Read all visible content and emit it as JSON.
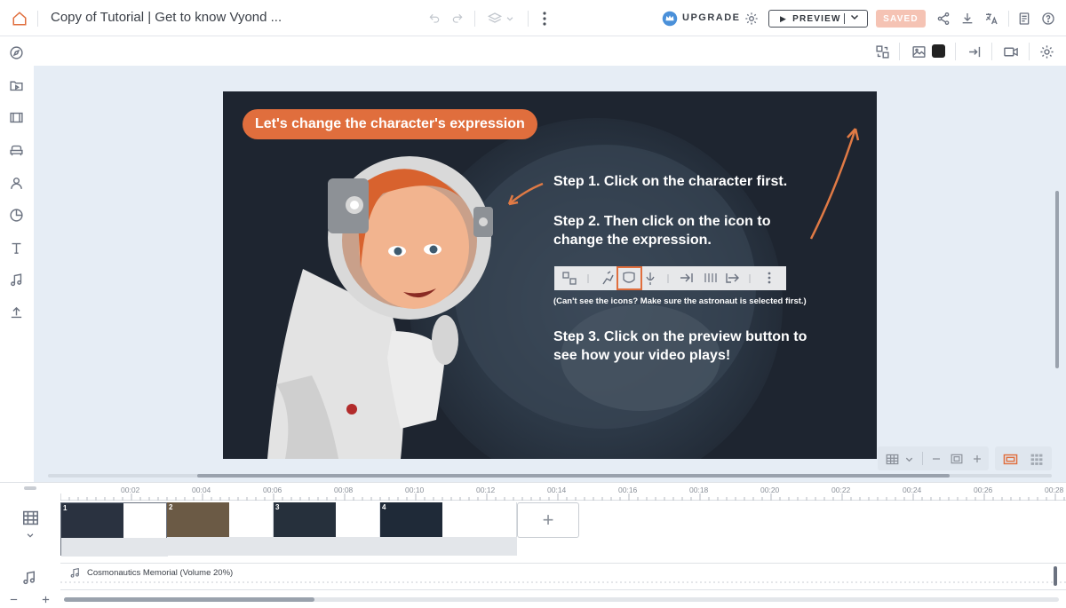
{
  "app": {
    "title": "Copy of Tutorial | Get to know Vyond ...",
    "accent_color": "#e06e3d"
  },
  "topbar": {
    "upgrade_label": "UPGRADE",
    "preview_label": "PREVIEW",
    "saved_label": "SAVED",
    "icons": [
      "home-icon",
      "undo-icon",
      "redo-icon",
      "layers-icon",
      "more-vertical-icon",
      "crown-icon",
      "settings-icon",
      "share-icon",
      "download-icon",
      "translate-icon",
      "notes-icon",
      "help-icon"
    ]
  },
  "left_rail": {
    "icons": [
      "compass-icon",
      "media-library-icon",
      "scenes-icon",
      "props-icon",
      "characters-icon",
      "charts-icon",
      "text-icon",
      "music-icon",
      "upload-icon"
    ]
  },
  "scene": {
    "heading": "Let's change the character's expression",
    "step1": "Step 1. Click on the character first.",
    "step2": "Step 2. Then click on the icon to change the expression.",
    "note": "(Can't see the icons? Make sure the astronaut is selected first.)",
    "step3": "Step 3. Click on the preview button to see how your video plays!"
  },
  "timeline": {
    "ticks": [
      "00:02",
      "00:04",
      "00:06",
      "00:08",
      "00:10",
      "00:12",
      "00:14",
      "00:16",
      "00:18",
      "00:20",
      "00:22",
      "00:24",
      "00:26",
      "00:28"
    ],
    "scenes": [
      {
        "number": "1",
        "color": "#2a3240"
      },
      {
        "number": "2",
        "color": "#6b5a45"
      },
      {
        "number": "3",
        "color": "#26303c"
      },
      {
        "number": "4",
        "color": "#1f2a38"
      }
    ],
    "add_scene_label": "+",
    "audio_track": "Cosmonautics Memorial (Volume 20%)"
  }
}
